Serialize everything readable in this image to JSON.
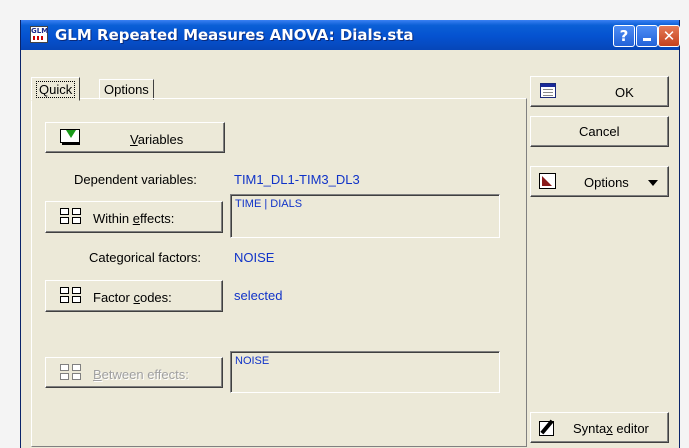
{
  "window": {
    "title": "GLM Repeated Measures ANOVA: Dials.sta",
    "app_icon_text": "GLM",
    "help_glyph": "?",
    "close_glyph": "✕"
  },
  "tabs": [
    {
      "label": "Quick",
      "active": true
    },
    {
      "label": "Options",
      "active": false
    }
  ],
  "quick": {
    "variables_button": {
      "pre": "",
      "u": "V",
      "post": "ariables"
    },
    "dependent_label": "Dependent variables:",
    "dependent_value": "TIM1_DL1-TIM3_DL3",
    "within_button": {
      "pre": "Within ",
      "u": "e",
      "post": "ffects:"
    },
    "within_value": "TIME | DIALS",
    "categorical_label": "Categorical factors:",
    "categorical_value": "NOISE",
    "factor_button": {
      "pre": "Factor ",
      "u": "c",
      "post": "odes:"
    },
    "factor_value": "selected",
    "between_button": {
      "pre": "",
      "u": "B",
      "post": "etween effects:"
    },
    "between_value": "NOISE"
  },
  "side": {
    "ok_label": "OK",
    "cancel_label": "Cancel",
    "options_label": "Options",
    "syntax_button": {
      "pre": "Synta",
      "u": "x",
      "post": " editor"
    }
  },
  "colors": {
    "titlebar": "#0552d0",
    "value_text": "#1033c8",
    "dialog_bg": "#ece9d8",
    "close_button": "#c4411d"
  }
}
